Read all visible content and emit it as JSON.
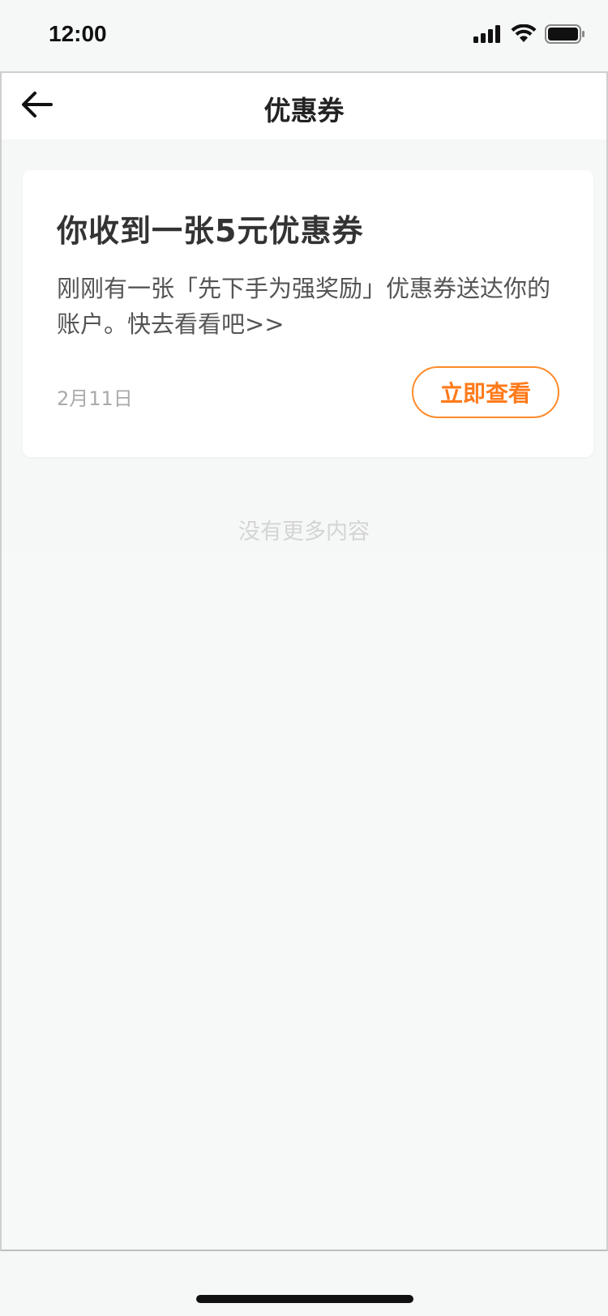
{
  "status_bar": {
    "time": "12:00"
  },
  "nav": {
    "title": "优惠券",
    "back_icon": "arrow-left-icon"
  },
  "notification": {
    "title": "你收到一张5元优惠券",
    "body": "刚刚有一张「先下手为强奖励」优惠券送达你的账户。快去看看吧>>",
    "date": "2月11日",
    "action_label": "立即查看"
  },
  "footer": {
    "no_more_text": "没有更多内容"
  },
  "colors": {
    "accent": "#ff7a1a",
    "background": "#f6f7f7",
    "card": "#ffffff"
  }
}
